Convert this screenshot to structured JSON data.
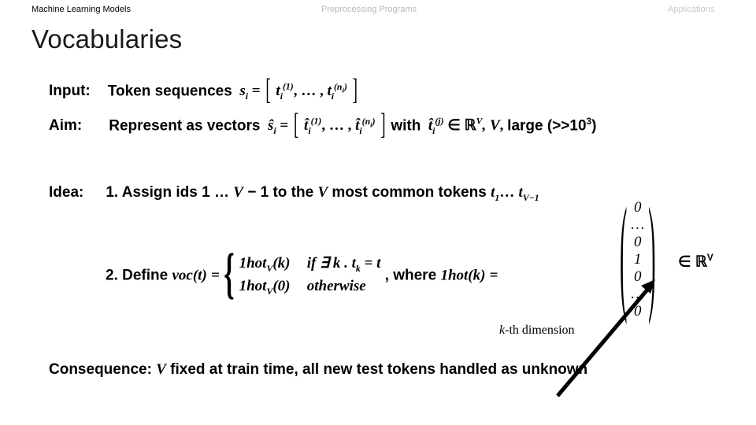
{
  "topnav": {
    "items": [
      {
        "label": "Machine Learning Models",
        "state": "active"
      },
      {
        "label": "Preprocessing Programs",
        "state": "dim"
      },
      {
        "label": "Applications",
        "state": "dim"
      }
    ]
  },
  "slide": {
    "title": "Vocabularies"
  },
  "content": {
    "input": {
      "label": "Input:",
      "text": "Token sequences",
      "var": "s",
      "var_sub": "i",
      "eq": "=",
      "bracket_open": "[",
      "term1": "t",
      "term1_sub": "i",
      "term1_sup": "(1)",
      "ellipsis": ", … ,",
      "term2": "t",
      "term2_sub": "i",
      "term2_sup": "(n",
      "term2_sup_tail": ")",
      "term2_sup_sub": "i",
      "bracket_close": "]"
    },
    "aim": {
      "label": "Aim:",
      "text": "Represent as vectors",
      "var": "ŝ",
      "var_sub": "i",
      "eq": "=",
      "bracket_open": "[",
      "term1": "t̂",
      "term1_sub": "i",
      "term1_sup": "(1)",
      "ellipsis": ", … ,",
      "term2": "t̂",
      "term2_sub": "i",
      "term2_sup": "(n",
      "term2_sup_sub": "i",
      "term2_sup_tail": ")",
      "bracket_close": "]",
      "with": "with",
      "hat": "t̂",
      "hat_sub": "i",
      "hat_sup": "(j)",
      "in": "∈",
      "field": "ℝ",
      "field_sup": "V",
      "comma_v": ", V",
      "large": "large (>>10",
      "large_sup": "3",
      "large_tail": ")"
    },
    "idea": {
      "label": "Idea:",
      "line1_a": "1. Assign ids 1 …",
      "line1_V": "V",
      "line1_b": "− 1 to the",
      "line1_V2": "V",
      "line1_c": "most common tokens",
      "line1_t1": "t",
      "line1_t1_sub": "1",
      "line1_dots": "…",
      "line1_t2": "t",
      "line1_t2_sub": "V−1"
    },
    "define": {
      "prefix": "2. Define",
      "func": "voc",
      "func_arg": "(t)",
      "eq": "=",
      "case1_main": "1hot",
      "case1_sub": "V",
      "case1_arg": "(k)",
      "case1_cond": "if ∃ k . t",
      "case1_cond_sub": "k",
      "case1_cond_tail": "= t",
      "case2_main": "1hot",
      "case2_sub": "V",
      "case2_arg": "(0)",
      "case2_cond": "otherwise",
      "where": ", where",
      "where_func": "1hot",
      "where_arg": "(k)",
      "where_eq": "="
    },
    "vector": {
      "values": [
        "0",
        "…",
        "0",
        "1",
        "0",
        "…",
        "0"
      ],
      "in": "∈",
      "field": "ℝ",
      "field_sup": "V"
    },
    "annotation": {
      "kth_k": "k",
      "kth_rest": "-th dimension"
    },
    "consequence": {
      "label": "Consequence:",
      "var": "V",
      "text": "fixed at train time, all new test tokens handled as unknown"
    }
  },
  "colors": {
    "text": "#000000",
    "dim": "#bcbcbc",
    "title": "#1a1a1a",
    "background": "#ffffff"
  }
}
